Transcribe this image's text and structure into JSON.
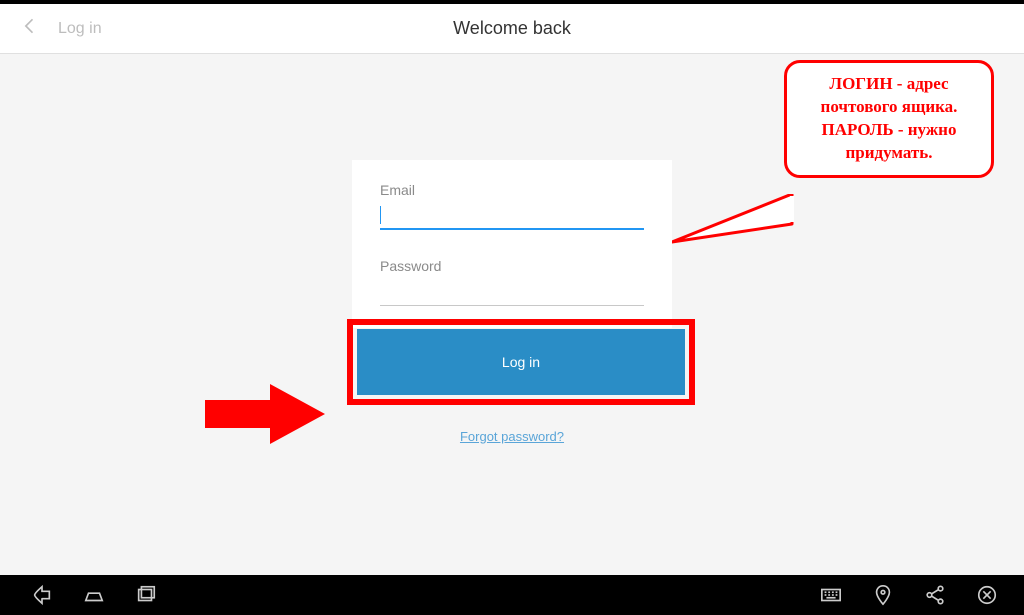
{
  "header": {
    "back_label": "Log in",
    "title": "Welcome back"
  },
  "form": {
    "email_label": "Email",
    "email_value": "",
    "password_label": "Password",
    "password_value": ""
  },
  "actions": {
    "login_label": "Log in",
    "forgot_label": "Forgot password?"
  },
  "annotation": {
    "callout_text": "ЛОГИН - адрес почтового ящика.\nПАРОЛЬ - нужно придумать."
  }
}
